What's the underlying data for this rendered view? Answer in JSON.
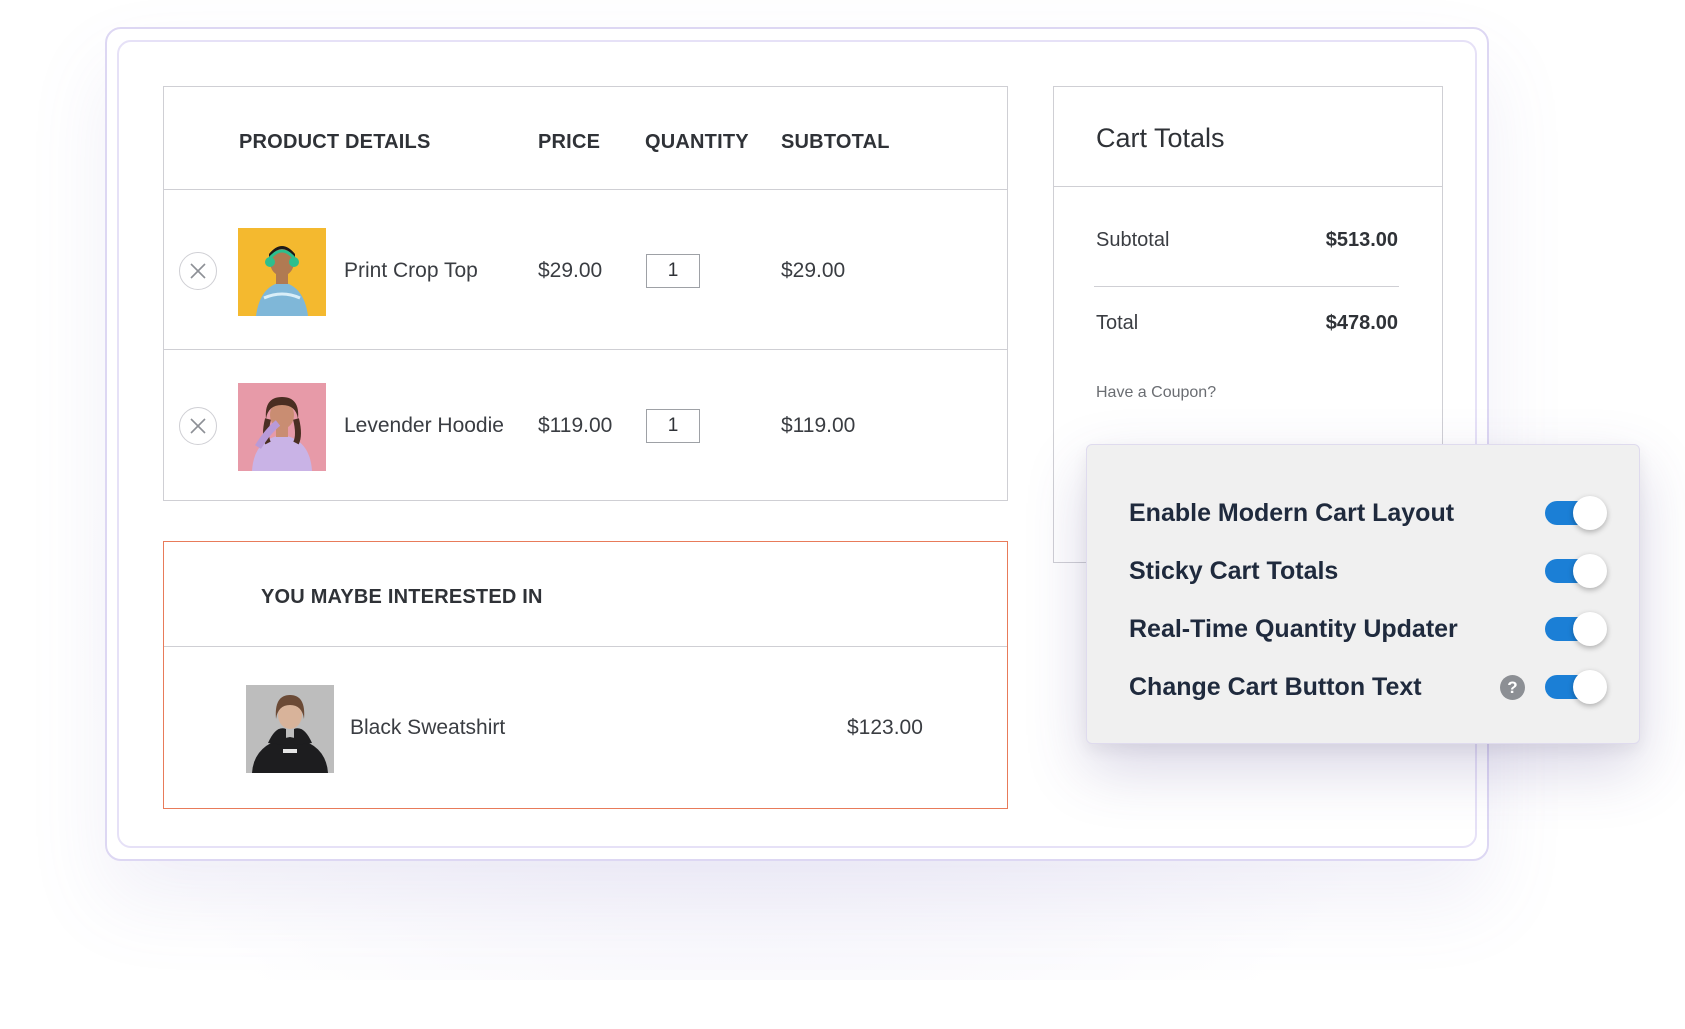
{
  "cart": {
    "headers": {
      "product": "PRODUCT DETAILS",
      "price": "PRICE",
      "quantity": "QUANTITY",
      "subtotal": "SUBTOTAL"
    },
    "items": [
      {
        "name": "Print Crop Top",
        "price": "$29.00",
        "quantity": "1",
        "subtotal": "$29.00",
        "thumb_color": "#f4b92f"
      },
      {
        "name": "Levender Hoodie",
        "price": "$119.00",
        "quantity": "1",
        "subtotal": "$119.00",
        "thumb_color": "#e79aa8"
      }
    ]
  },
  "upsell": {
    "title": "YOU MAYBE INTERESTED IN",
    "item": {
      "name": "Black Sweatshirt",
      "price": "$123.00",
      "thumb_color": "#bdbdbd"
    }
  },
  "totals": {
    "title": "Cart Totals",
    "subtotal_label": "Subtotal",
    "subtotal_value": "$513.00",
    "total_label": "Total",
    "total_value": "$478.00",
    "coupon_link": "Have a Coupon?"
  },
  "settings": {
    "items": [
      {
        "label": "Enable Modern Cart Layout",
        "enabled": true
      },
      {
        "label": "Sticky Cart Totals",
        "enabled": true
      },
      {
        "label": "Real-Time Quantity Updater",
        "enabled": true
      },
      {
        "label": "Change Cart Button Text",
        "enabled": true,
        "help_icon": "?"
      }
    ],
    "accent_color": "#1b7fd6"
  }
}
